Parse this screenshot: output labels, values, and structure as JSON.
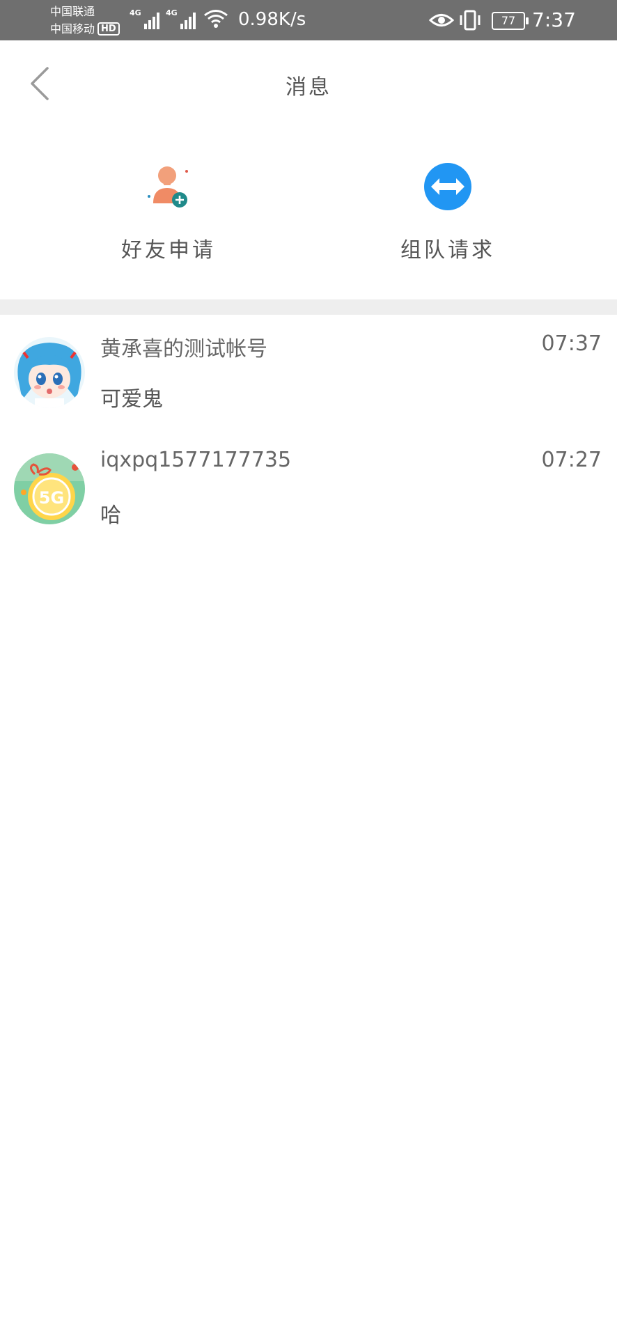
{
  "status_bar": {
    "carrier_1": "中国联通",
    "carrier_2": "中国移动",
    "hd_badge": "HD",
    "network_1": "4G",
    "network_2": "4G",
    "speed": "0.98K/s",
    "battery": "77",
    "time": "7:37"
  },
  "header": {
    "title": "消息"
  },
  "quick_actions": [
    {
      "label": "好友申请",
      "icon": "add-friend-icon"
    },
    {
      "label": "组队请求",
      "icon": "swap-arrows-icon"
    }
  ],
  "conversations": [
    {
      "name": "黄承喜的测试帐号",
      "time": "07:37",
      "message": "可爱鬼",
      "avatar": "anime-girl-avatar"
    },
    {
      "name": "iqxpq1577177735",
      "time": "07:27",
      "message": "哈",
      "avatar": "5g-gift-avatar"
    }
  ],
  "colors": {
    "status_bar": "#6f6f6f",
    "accent_blue": "#2196f3",
    "divider": "#eeeeee"
  }
}
